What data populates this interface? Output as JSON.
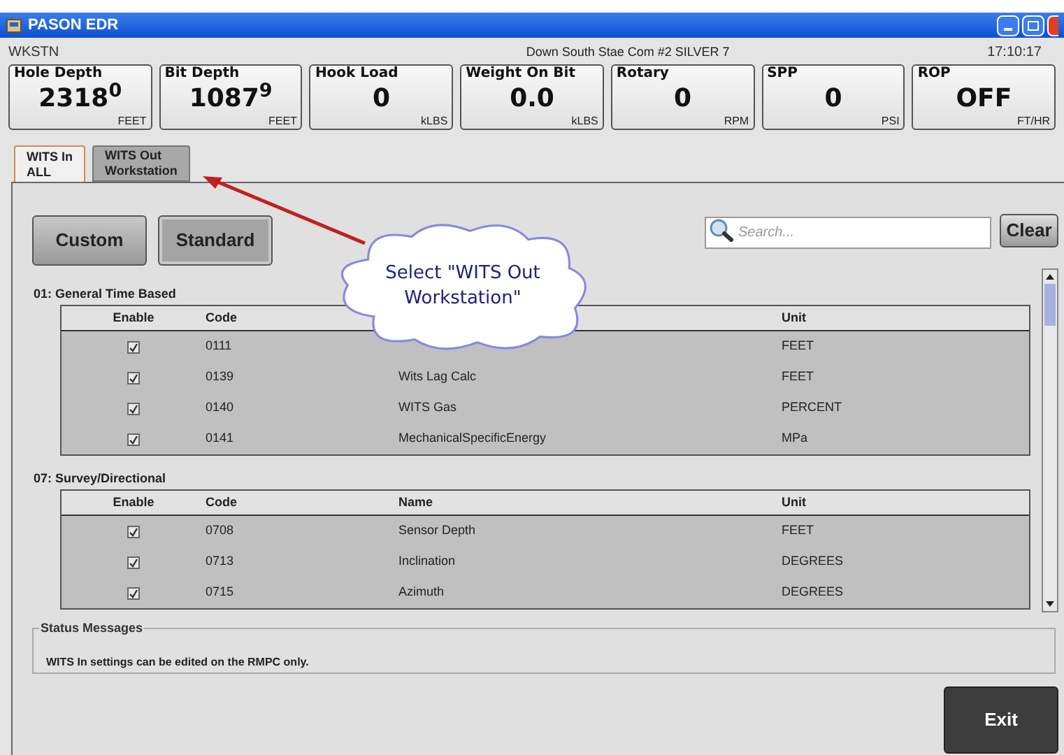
{
  "window": {
    "title": "PASON EDR"
  },
  "header": {
    "station": "WKSTN",
    "well": "Down South Stae Com #2 SILVER 7",
    "time": "17:10:17"
  },
  "gauges": [
    {
      "label": "Hole Depth",
      "value": "2318$^{0}$",
      "unit": "FEET"
    },
    {
      "label": "Bit Depth",
      "value": "1087$^{9}$",
      "unit": "FEET"
    },
    {
      "label": "Hook Load",
      "value": "0",
      "unit": "kLBS"
    },
    {
      "label": "Weight On Bit",
      "value": "0.0",
      "unit": "kLBS"
    },
    {
      "label": "Rotary",
      "value": "0",
      "unit": "RPM"
    },
    {
      "label": "SPP",
      "value": "0",
      "unit": "PSI"
    },
    {
      "label": "ROP",
      "value": "OFF",
      "unit": "FT/HR"
    }
  ],
  "tabs": [
    {
      "lines": [
        "WITS In",
        "ALL"
      ],
      "selected": true
    },
    {
      "lines": [
        "WITS Out",
        "Workstation"
      ],
      "selected": false
    }
  ],
  "mode_buttons": [
    {
      "label": "Custom",
      "selected": false
    },
    {
      "label": "Standard",
      "selected": true
    }
  ],
  "search": {
    "placeholder": "Search..."
  },
  "clear_button": "Clear",
  "callout": {
    "text": "Select \"WITS Out Workstation\""
  },
  "sections": [
    {
      "title": "01: General Time Based",
      "columns": [
        {
          "kind": "enable",
          "label": "Enable"
        },
        {
          "kind": "code",
          "label": "Code"
        },
        {
          "kind": "unit",
          "label": "Unit"
        }
      ],
      "rows": [
        {
          "checked": true,
          "code": "0111",
          "unit": "FEET"
        },
        {
          "checked": true,
          "code": "0139",
          "name": "Wits Lag Calc",
          "unit": "FEET"
        },
        {
          "checked": true,
          "code": "0140",
          "name": "WITS Gas",
          "unit": "PERCENT"
        },
        {
          "checked": true,
          "code": "0141",
          "name": "MechanicalSpecificEnergy",
          "unit": "MPa"
        }
      ]
    },
    {
      "title": "07: Survey/Directional",
      "columns": [
        {
          "kind": "enable",
          "label": "Enable"
        },
        {
          "kind": "code",
          "label": "Code"
        },
        {
          "kind": "name",
          "label": "Name"
        },
        {
          "kind": "unit",
          "label": "Unit"
        }
      ],
      "rows": [
        {
          "checked": true,
          "code": "0708",
          "name": "Sensor Depth",
          "unit": "FEET"
        },
        {
          "checked": true,
          "code": "0713",
          "name": "Inclination",
          "unit": "DEGREES"
        },
        {
          "checked": true,
          "code": "0715",
          "name": "Azimuth",
          "unit": "DEGREES"
        }
      ]
    }
  ],
  "status": {
    "title": "Status Messages",
    "message": "WITS In settings can be edited on the RMPC only."
  },
  "exit_button": "Exit"
}
